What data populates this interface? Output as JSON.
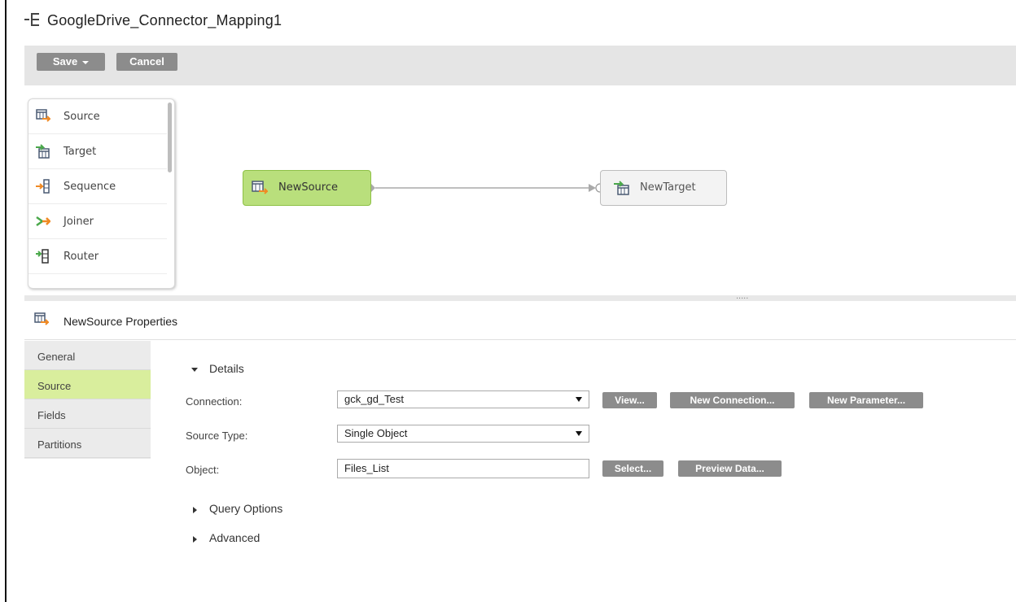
{
  "header": {
    "title": "GoogleDrive_Connector_Mapping1",
    "icon": "mapping-icon"
  },
  "toolbar": {
    "save_label": "Save",
    "cancel_label": "Cancel"
  },
  "palette": {
    "items": [
      {
        "label": "Source",
        "icon": "source-icon"
      },
      {
        "label": "Target",
        "icon": "target-icon"
      },
      {
        "label": "Sequence",
        "icon": "sequence-icon"
      },
      {
        "label": "Joiner",
        "icon": "joiner-icon"
      },
      {
        "label": "Router",
        "icon": "router-icon"
      }
    ],
    "more": ". . ."
  },
  "canvas": {
    "source_node": "NewSource",
    "target_node": "NewTarget"
  },
  "splitter": {
    "grip": "....."
  },
  "properties": {
    "title": "NewSource Properties",
    "nav": [
      "General",
      "Source",
      "Fields",
      "Partitions"
    ],
    "active_nav": "Source",
    "details_label": "Details",
    "connection_label": "Connection:",
    "connection_value": "gck_gd_Test",
    "view_button": "View...",
    "new_connection_button": "New Connection...",
    "new_parameter_button": "New Parameter...",
    "source_type_label": "Source Type:",
    "source_type_value": "Single Object",
    "object_label": "Object:",
    "object_value": "Files_List",
    "select_button": "Select...",
    "preview_button": "Preview Data...",
    "query_options_label": "Query Options",
    "advanced_label": "Advanced"
  },
  "colors": {
    "toolbar_bg": "#e5e5e5",
    "button_gray": "#8c8c8c",
    "source_node_green": "#b9df7c",
    "active_nav_green": "#d9ee9d",
    "source_orange": "#f08a24",
    "target_green": "#4aa84a"
  }
}
